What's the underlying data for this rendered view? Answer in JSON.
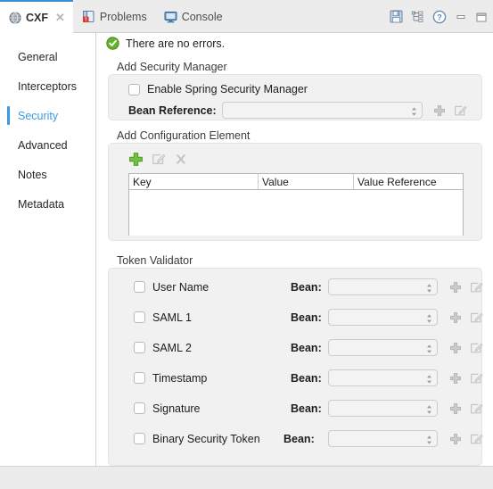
{
  "window": {
    "tools": [
      {
        "name": "save-icon",
        "title": "Save"
      },
      {
        "name": "hierarchy-icon",
        "title": "Outline"
      },
      {
        "name": "help-icon",
        "title": "Help"
      },
      {
        "name": "minimize-icon",
        "title": "Minimize"
      },
      {
        "name": "maximize-icon",
        "title": "Maximize"
      }
    ]
  },
  "tabs": [
    {
      "label": "CXF",
      "icon": "globe-icon",
      "active": true,
      "closeable": true
    },
    {
      "label": "Problems",
      "icon": "problems-icon",
      "active": false,
      "closeable": false
    },
    {
      "label": "Console",
      "icon": "console-icon",
      "active": false,
      "closeable": false
    }
  ],
  "sidebar": {
    "items": [
      {
        "label": "General",
        "selected": false
      },
      {
        "label": "Interceptors",
        "selected": false
      },
      {
        "label": "Security",
        "selected": true
      },
      {
        "label": "Advanced",
        "selected": false
      },
      {
        "label": "Notes",
        "selected": false
      },
      {
        "label": "Metadata",
        "selected": false
      }
    ]
  },
  "status": {
    "icon": "success-check-icon",
    "message": "There are no errors."
  },
  "security_manager": {
    "title": "Add Security Manager",
    "enable_checkbox": {
      "label": "Enable Spring Security Manager",
      "checked": false
    },
    "bean_reference": {
      "label": "Bean Reference:",
      "value": "",
      "placeholder": "",
      "options": []
    },
    "add_label": "Add",
    "edit_label": "Edit"
  },
  "configuration_element": {
    "title": "Add Configuration Element",
    "toolbar": [
      {
        "name": "add-icon",
        "label": "Add",
        "enabled": true
      },
      {
        "name": "edit-icon",
        "label": "Edit",
        "enabled": false
      },
      {
        "name": "delete-icon",
        "label": "Delete",
        "enabled": false
      }
    ],
    "columns": [
      "Key",
      "Value",
      "Value Reference"
    ],
    "rows": []
  },
  "token_validator": {
    "title": "Token Validator",
    "bean_label": "Bean:",
    "rows": [
      {
        "label": "User Name",
        "checked": false,
        "bean_value": ""
      },
      {
        "label": "SAML 1",
        "checked": false,
        "bean_value": ""
      },
      {
        "label": "SAML 2",
        "checked": false,
        "bean_value": ""
      },
      {
        "label": "Timestamp",
        "checked": false,
        "bean_value": ""
      },
      {
        "label": "Signature",
        "checked": false,
        "bean_value": ""
      },
      {
        "label": "Binary Security Token",
        "checked": false,
        "bean_value": ""
      }
    ]
  },
  "colors": {
    "accent": "#3d9ae0",
    "success": "#5fb236",
    "add_green": "#6cbf2f",
    "panel": "#f1f1f1",
    "chrome": "#ececec"
  }
}
